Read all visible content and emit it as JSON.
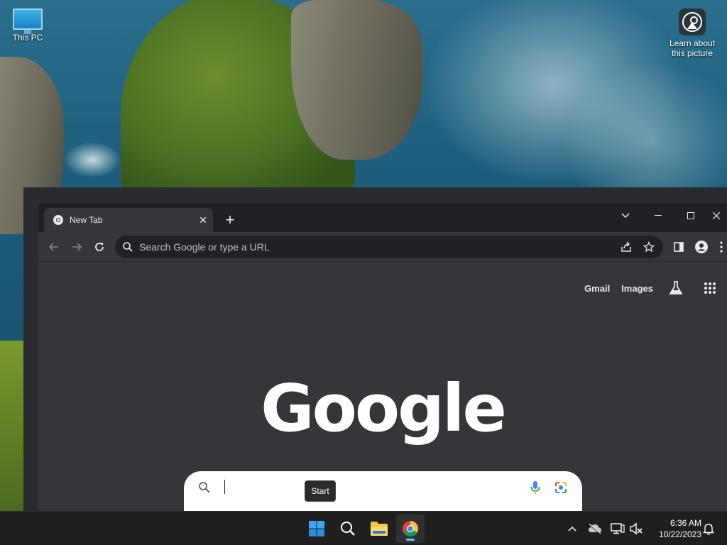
{
  "desktop": {
    "icons": [
      {
        "label": "This PC",
        "icon": "monitor-icon"
      },
      {
        "label": "Learn about this picture",
        "icon": "learn-picture-icon"
      }
    ]
  },
  "browser": {
    "tab": {
      "title": "New Tab",
      "icon": "chrome-icon"
    },
    "omnibox": {
      "placeholder": "Search Google or type a URL"
    },
    "ntp": {
      "links": {
        "gmail": "Gmail",
        "images": "Images"
      },
      "logo": "Google",
      "search_value": ""
    }
  },
  "tooltip": {
    "text": "Start"
  },
  "taskbar": {
    "apps": [
      "start",
      "search",
      "file-explorer",
      "chrome"
    ],
    "clock": {
      "time": "6:36 AM",
      "date": "10/22/2023"
    }
  },
  "colors": {
    "accent": "#60cdff",
    "browser_bg": "#35363a",
    "tabstrip_bg": "#202124"
  }
}
